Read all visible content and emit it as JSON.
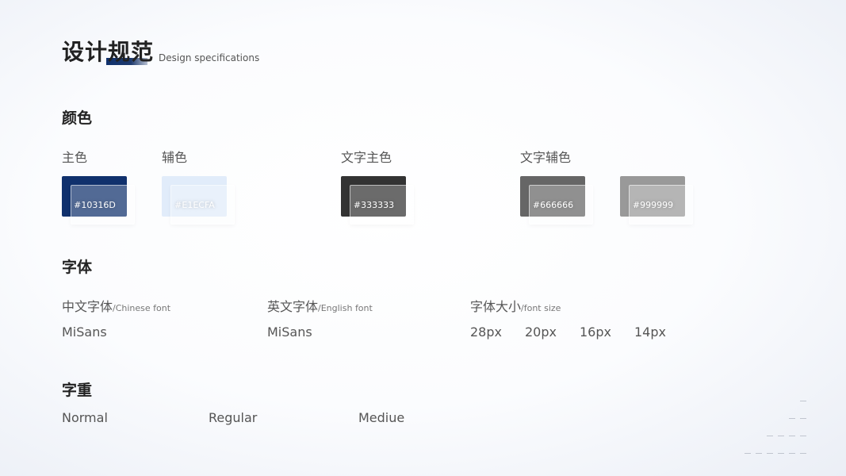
{
  "header": {
    "title": "设计规范",
    "subtitle": "Design specifications"
  },
  "colors": {
    "section_title": "颜色",
    "groups": [
      {
        "label": "主色",
        "swatches": [
          {
            "hex": "#10316D",
            "text": "#10316D"
          }
        ]
      },
      {
        "label": "辅色",
        "swatches": [
          {
            "hex": "#E1ECFA",
            "text": "#E1ECFA"
          }
        ]
      },
      {
        "label": "文字主色",
        "swatches": [
          {
            "hex": "#333333",
            "text": "#333333"
          }
        ]
      },
      {
        "label": "文字辅色",
        "swatches": [
          {
            "hex": "#666666",
            "text": "#666666"
          },
          {
            "hex": "#999999",
            "text": "#999999"
          }
        ]
      }
    ]
  },
  "fonts": {
    "section_title": "字体",
    "chinese": {
      "label": "中文字体",
      "sub": "/Chinese font",
      "value": "MiSans"
    },
    "english": {
      "label": "英文字体",
      "sub": "/English font",
      "value": "MiSans"
    },
    "size": {
      "label": "字体大小",
      "sub": "/font size",
      "values": [
        "28px",
        "20px",
        "16px",
        "14px"
      ]
    }
  },
  "weights": {
    "section_title": "字重",
    "items": [
      "Normal",
      "Regular",
      "Mediue"
    ]
  },
  "decor": {
    "dash_counts": [
      1,
      2,
      4,
      6
    ],
    "line_color": "#C0C5CF"
  }
}
